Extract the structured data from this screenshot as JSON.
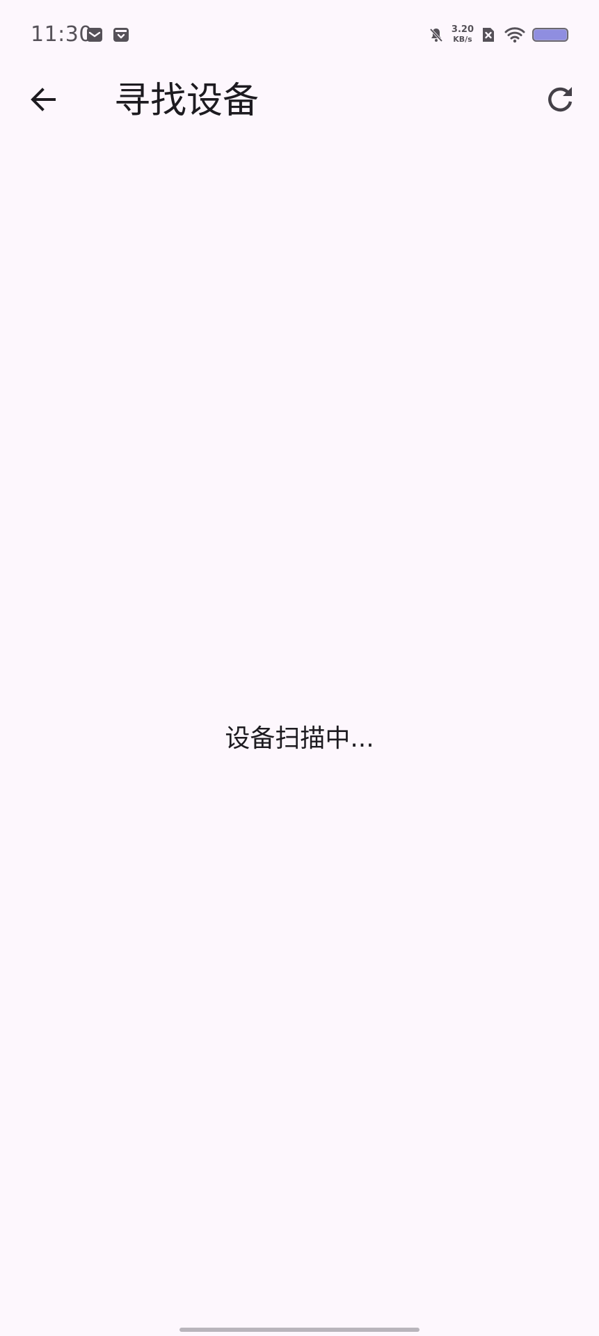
{
  "status_bar": {
    "time": "11:30",
    "left_icons": [
      "mail-notification-icon",
      "archive-notification-icon"
    ],
    "net_speed_value": "3.20",
    "net_speed_unit": "KB/s",
    "right_icons": [
      "bell-off-icon",
      "sim-disabled-icon",
      "wifi-icon",
      "battery-icon"
    ],
    "battery_level": 1.0
  },
  "app_bar": {
    "title": "寻找设备",
    "back_icon": "arrow-back-icon",
    "refresh_icon": "refresh-icon"
  },
  "content": {
    "scan_status": "设备扫描中..."
  },
  "colors": {
    "background": "#fdf7fd",
    "text_primary": "#1d1b20",
    "icon": "#444048",
    "battery": "#a7a6d9"
  }
}
